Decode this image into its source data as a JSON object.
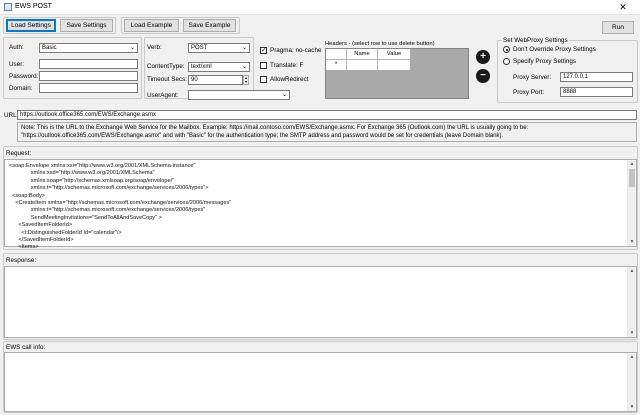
{
  "window": {
    "title": "EWS POST",
    "close_glyph": "✕"
  },
  "toolbar": {
    "load_settings": "Load Settings",
    "save_settings": "Save Settings",
    "load_example": "Load Example",
    "save_example": "Save Example",
    "run": "Run"
  },
  "auth": {
    "auth_label": "Auth:",
    "auth_value": "Basic",
    "user_label": "User:",
    "user_value": "",
    "password_label": "Password:",
    "password_value": "",
    "domain_label": "Domain:",
    "domain_value": ""
  },
  "request_opts": {
    "verb_label": "Verb:",
    "verb_value": "POST",
    "content_type_label": "ContentType:",
    "content_type_value": "text/xml",
    "timeout_label": "Timeout Secs:",
    "timeout_value": "90",
    "useragent_label": "UserAgent:",
    "useragent_value": ""
  },
  "flags": {
    "pragma_label": "Pragma: no-cache",
    "pragma_checked": true,
    "translate_label": "Translate: F",
    "translate_checked": false,
    "allow_redirect_label": "AllowRedirect",
    "allow_redirect_checked": false
  },
  "headers": {
    "label": "Headers - (select row to use delete button)",
    "columns": [
      "Name",
      "Value"
    ],
    "new_row_marker": "*",
    "add_glyph": "+",
    "remove_glyph": "−"
  },
  "proxy": {
    "group_label": "Set WebProxy Settings",
    "dont_override_label": "Don't Override Proxy Settings",
    "specify_label": "Specify Proxy Settings",
    "selected": "dont_override",
    "server_label": "Proxy Server:",
    "server_value": "127.0.0.1",
    "port_label": "Proxy Port:",
    "port_value": "8888"
  },
  "url": {
    "label": "URL:",
    "value": "https://outlook.office365.com/EWS/Exchange.asmx",
    "note": "Note:  This is the URL to the Exchange Web Service for the Mailbox.  Example:  https://mail.contoso.com/EWS/Exchange.asmx.  For Exchange 365 (Outlook.com) the URL is usually going to be: \"https://outlook.office365.com/EWS/Exchange.asmx\" and with \"Basic\" for the authentication type; the SMTP address and password would be set for credentials (leave Domain blank)."
  },
  "request": {
    "label": "Request:",
    "lines": [
      "<soap:Envelope xmlns:xsi=\"http://www.w3.org/2001/XMLSchema-instance\"",
      "              xmlns:xsd=\"http://www.w3.org/2001/XMLSchema\"",
      "              xmlns:soap=\"http://schemas.xmlsoap.org/soap/envelope/\"",
      "              xmlns:t=\"http://schemas.microsoft.com/exchange/services/2006/types\">",
      "  <soap:Body>",
      "    <CreateItem xmlns=\"http://schemas.microsoft.com/exchange/services/2006/messages\"",
      "              xmlns:t=\"http://schemas.microsoft.com/exchange/services/2006/types\"",
      "              SendMeetingInvitations=\"SendToAllAndSaveCopy\" >",
      "      <SavedItemFolderId>",
      "        <t:DistinguishedFolderId Id=\"calendar\"/>",
      "      </SavedItemFolderId>",
      "      <Items>"
    ]
  },
  "response": {
    "label": "Response:",
    "value": ""
  },
  "call_info": {
    "label": "EWS call info:",
    "value": ""
  }
}
